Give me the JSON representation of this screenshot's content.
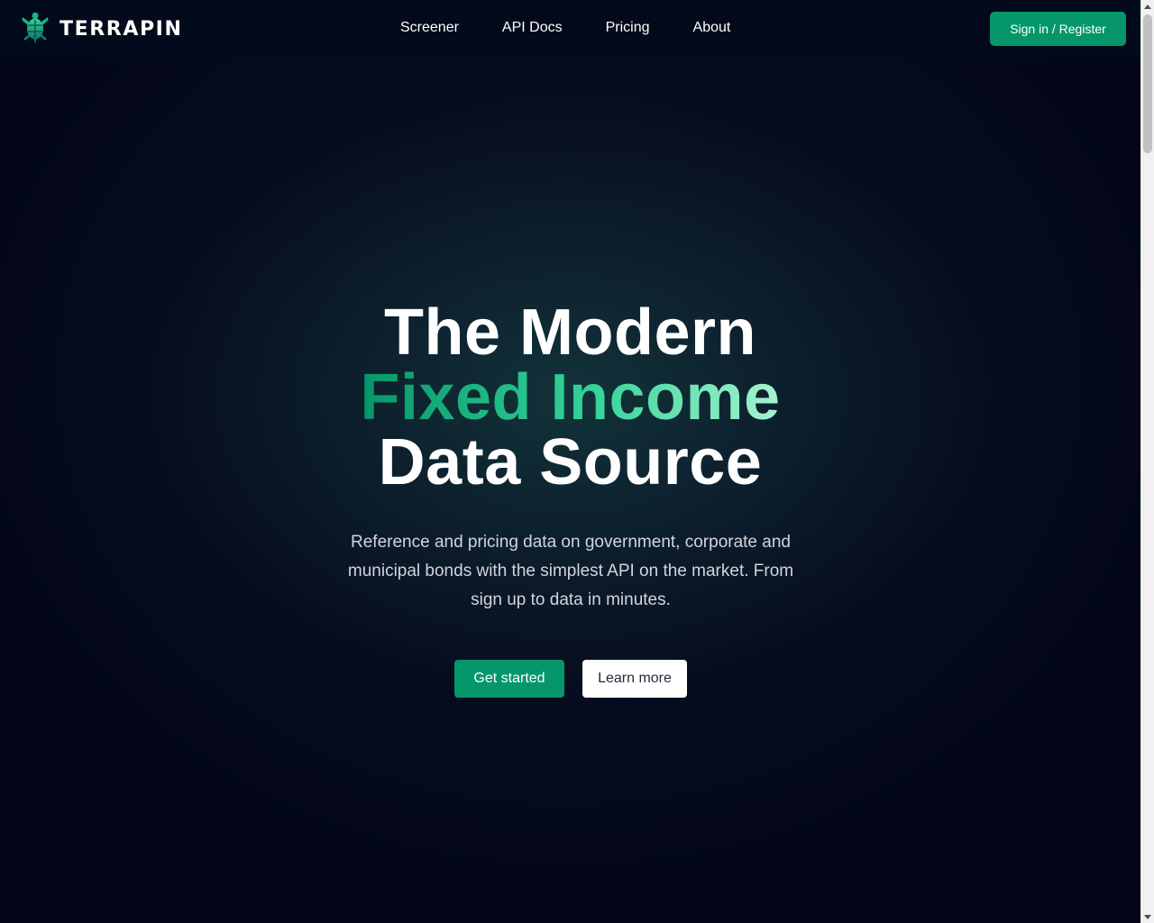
{
  "brand": {
    "name": "TERRAPIN",
    "logo_icon": "turtle-icon",
    "accent_color": "#059669"
  },
  "nav": {
    "items": [
      {
        "label": "Screener"
      },
      {
        "label": "API Docs"
      },
      {
        "label": "Pricing"
      },
      {
        "label": "About"
      }
    ],
    "signin_label": "Sign in / Register"
  },
  "hero": {
    "line1": "The Modern",
    "line2": "Fixed Income",
    "line3": "Data Source",
    "subtitle": "Reference and pricing data on government, corporate and municipal bonds with the simplest API on the market. From sign up to data in minutes.",
    "primary_cta": "Get started",
    "secondary_cta": "Learn more"
  },
  "scrollbar": {
    "icons": [
      "scroll-up-arrow-icon",
      "scroll-down-arrow-icon"
    ]
  }
}
